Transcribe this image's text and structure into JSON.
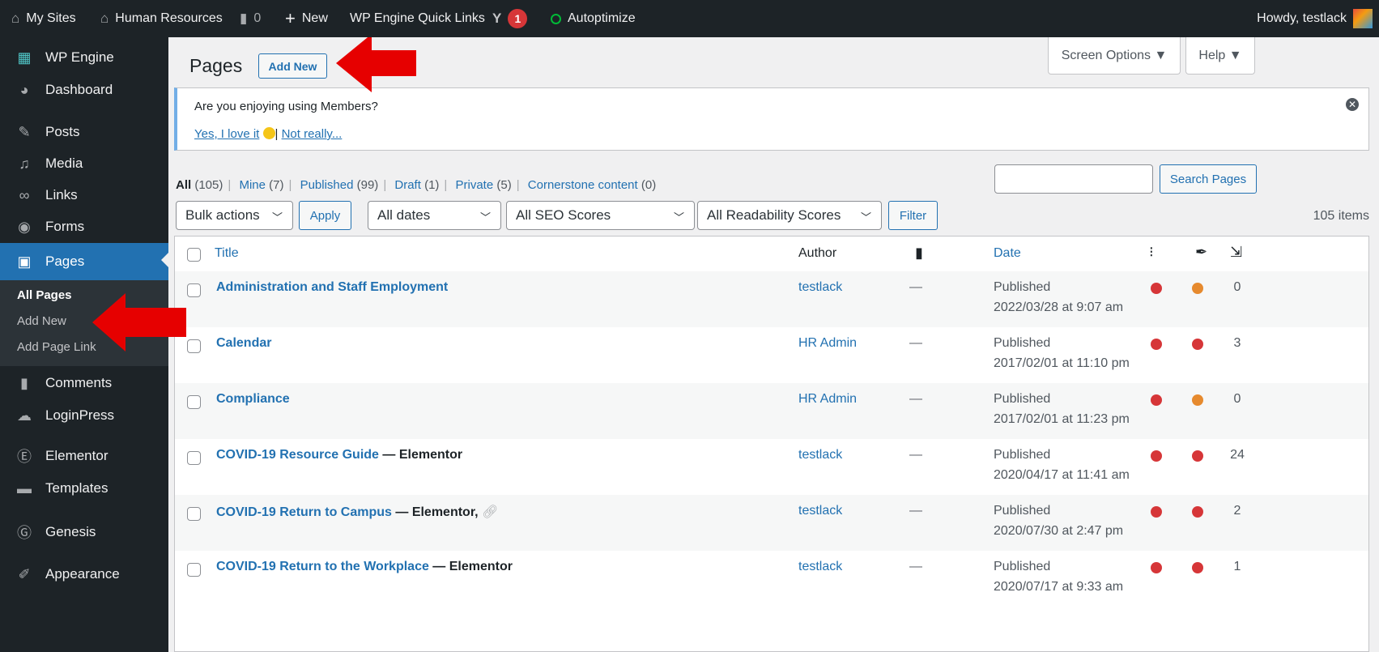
{
  "adminbar": {
    "my_sites": "My Sites",
    "site_name": "Human Resources",
    "comments_count": "0",
    "new_label": "New",
    "quick_links": "WP Engine Quick Links",
    "yoast_badge": "1",
    "autoptimize": "Autoptimize",
    "howdy": "Howdy, testlack"
  },
  "sidebar": {
    "items": [
      {
        "label": "WP Engine",
        "icon": "wp-engine-icon"
      },
      {
        "label": "Dashboard",
        "icon": "dashboard-icon"
      },
      {
        "label": "Posts",
        "icon": "pin-icon"
      },
      {
        "label": "Media",
        "icon": "media-icon"
      },
      {
        "label": "Links",
        "icon": "link-icon"
      },
      {
        "label": "Forms",
        "icon": "forms-icon"
      },
      {
        "label": "Pages",
        "icon": "pages-icon"
      },
      {
        "label": "Comments",
        "icon": "comment-icon"
      },
      {
        "label": "LoginPress",
        "icon": "loginpress-icon"
      },
      {
        "label": "Elementor",
        "icon": "elementor-icon"
      },
      {
        "label": "Templates",
        "icon": "folder-icon"
      },
      {
        "label": "Genesis",
        "icon": "genesis-icon"
      },
      {
        "label": "Appearance",
        "icon": "brush-icon"
      }
    ],
    "submenu": [
      "All Pages",
      "Add New",
      "Add Page Link"
    ]
  },
  "header": {
    "title": "Pages",
    "add_new": "Add New",
    "screen_options": "Screen Options ▼",
    "help": "Help ▼"
  },
  "notice": {
    "question": "Are you enjoying using Members?",
    "yes": "Yes, I love it",
    "no": "Not really..."
  },
  "views": [
    {
      "label": "All",
      "count": "(105)"
    },
    {
      "label": "Mine",
      "count": "(7)"
    },
    {
      "label": "Published",
      "count": "(99)"
    },
    {
      "label": "Draft",
      "count": "(1)"
    },
    {
      "label": "Private",
      "count": "(5)"
    },
    {
      "label": "Cornerstone content",
      "count": "(0)"
    }
  ],
  "search": {
    "button": "Search Pages",
    "value": ""
  },
  "filters": {
    "bulk": "Bulk actions",
    "apply": "Apply",
    "dates": "All dates",
    "seo": "All SEO Scores",
    "readability": "All Readability Scores",
    "filter": "Filter",
    "items_count": "105 items"
  },
  "table": {
    "headers": {
      "title": "Title",
      "author": "Author",
      "date": "Date"
    },
    "rows": [
      {
        "title": "Administration and Staff Employment",
        "state": "",
        "author": "testlack",
        "comments": "—",
        "status": "Published",
        "date": "2022/03/28 at 9:07 am",
        "seo": "#d63638",
        "read": "#e68a2e",
        "links": "0"
      },
      {
        "title": "Calendar",
        "state": "",
        "author": "HR Admin",
        "comments": "—",
        "status": "Published",
        "date": "2017/02/01 at 11:10 pm",
        "seo": "#d63638",
        "read": "#d63638",
        "links": "3"
      },
      {
        "title": "Compliance",
        "state": "",
        "author": "HR Admin",
        "comments": "—",
        "status": "Published",
        "date": "2017/02/01 at 11:23 pm",
        "seo": "#d63638",
        "read": "#e68a2e",
        "links": "0"
      },
      {
        "title": "COVID-19 Resource Guide",
        "state": " — Elementor",
        "author": "testlack",
        "comments": "—",
        "status": "Published",
        "date": "2020/04/17 at 11:41 am",
        "seo": "#d63638",
        "read": "#d63638",
        "links": "24"
      },
      {
        "title": "COVID-19 Return to Campus",
        "state": " — Elementor,",
        "author": "testlack",
        "comments": "—",
        "status": "Published",
        "date": "2020/07/30 at 2:47 pm",
        "seo": "#d63638",
        "read": "#d63638",
        "links": "2"
      },
      {
        "title": "COVID-19 Return to the Workplace",
        "state": " — Elementor",
        "author": "testlack",
        "comments": "—",
        "status": "Published",
        "date": "2020/07/17 at 9:33 am",
        "seo": "#d63638",
        "read": "#d63638",
        "links": "1"
      }
    ]
  },
  "colors": {
    "accent": "#2271b1",
    "arrow": "#e60000",
    "sidebar": "#1d2327"
  }
}
